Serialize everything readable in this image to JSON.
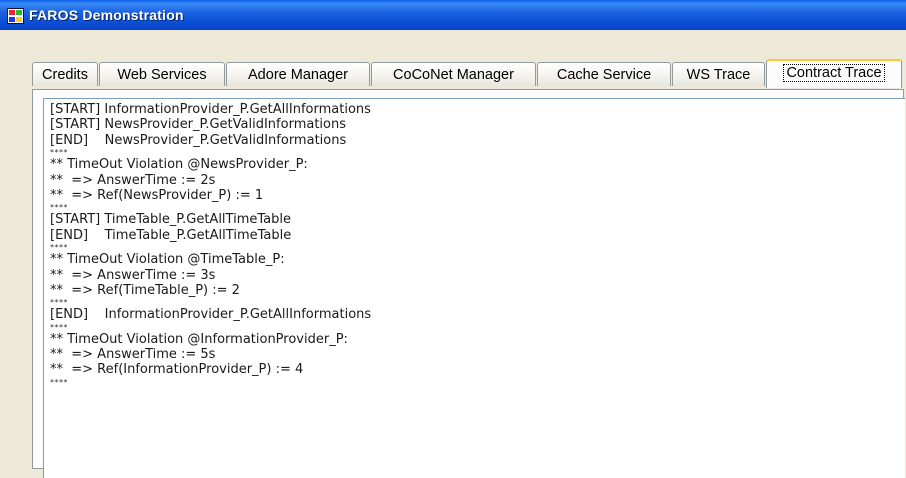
{
  "window": {
    "title": "FAROS Demonstration",
    "icon": "app-icon"
  },
  "tabs": [
    {
      "label": "Credits"
    },
    {
      "label": "Web Services"
    },
    {
      "label": "Adore Manager"
    },
    {
      "label": "CoCoNet Manager"
    },
    {
      "label": "Cache Service"
    },
    {
      "label": "WS Trace"
    },
    {
      "label": "Contract Trace"
    }
  ],
  "active_tab": "Contract Trace",
  "trace": {
    "lines": [
      {
        "text": "[START] InformationProvider_P.GetAllInformations",
        "kind": "line"
      },
      {
        "text": "[START] NewsProvider_P.GetValidInformations",
        "kind": "line"
      },
      {
        "text": "[END]    NewsProvider_P.GetValidInformations",
        "kind": "line"
      },
      {
        "text": "****",
        "kind": "sep"
      },
      {
        "text": "** TimeOut Violation @NewsProvider_P:",
        "kind": "line"
      },
      {
        "text": "**  => AnswerTime := 2s",
        "kind": "line"
      },
      {
        "text": "**  => Ref(NewsProvider_P) := 1",
        "kind": "line"
      },
      {
        "text": "****",
        "kind": "sep"
      },
      {
        "text": "[START] TimeTable_P.GetAllTimeTable",
        "kind": "line"
      },
      {
        "text": "[END]    TimeTable_P.GetAllTimeTable",
        "kind": "line"
      },
      {
        "text": "****",
        "kind": "sep"
      },
      {
        "text": "** TimeOut Violation @TimeTable_P:",
        "kind": "line"
      },
      {
        "text": "**  => AnswerTime := 3s",
        "kind": "line"
      },
      {
        "text": "**  => Ref(TimeTable_P) := 2",
        "kind": "line"
      },
      {
        "text": "****",
        "kind": "sep"
      },
      {
        "text": "[END]    InformationProvider_P.GetAllInformations",
        "kind": "line"
      },
      {
        "text": "****",
        "kind": "sep"
      },
      {
        "text": "** TimeOut Violation @InformationProvider_P:",
        "kind": "line"
      },
      {
        "text": "**  => AnswerTime := 5s",
        "kind": "line"
      },
      {
        "text": "**  => Ref(InformationProvider_P) := 4",
        "kind": "line"
      },
      {
        "text": "****",
        "kind": "sep"
      }
    ]
  }
}
